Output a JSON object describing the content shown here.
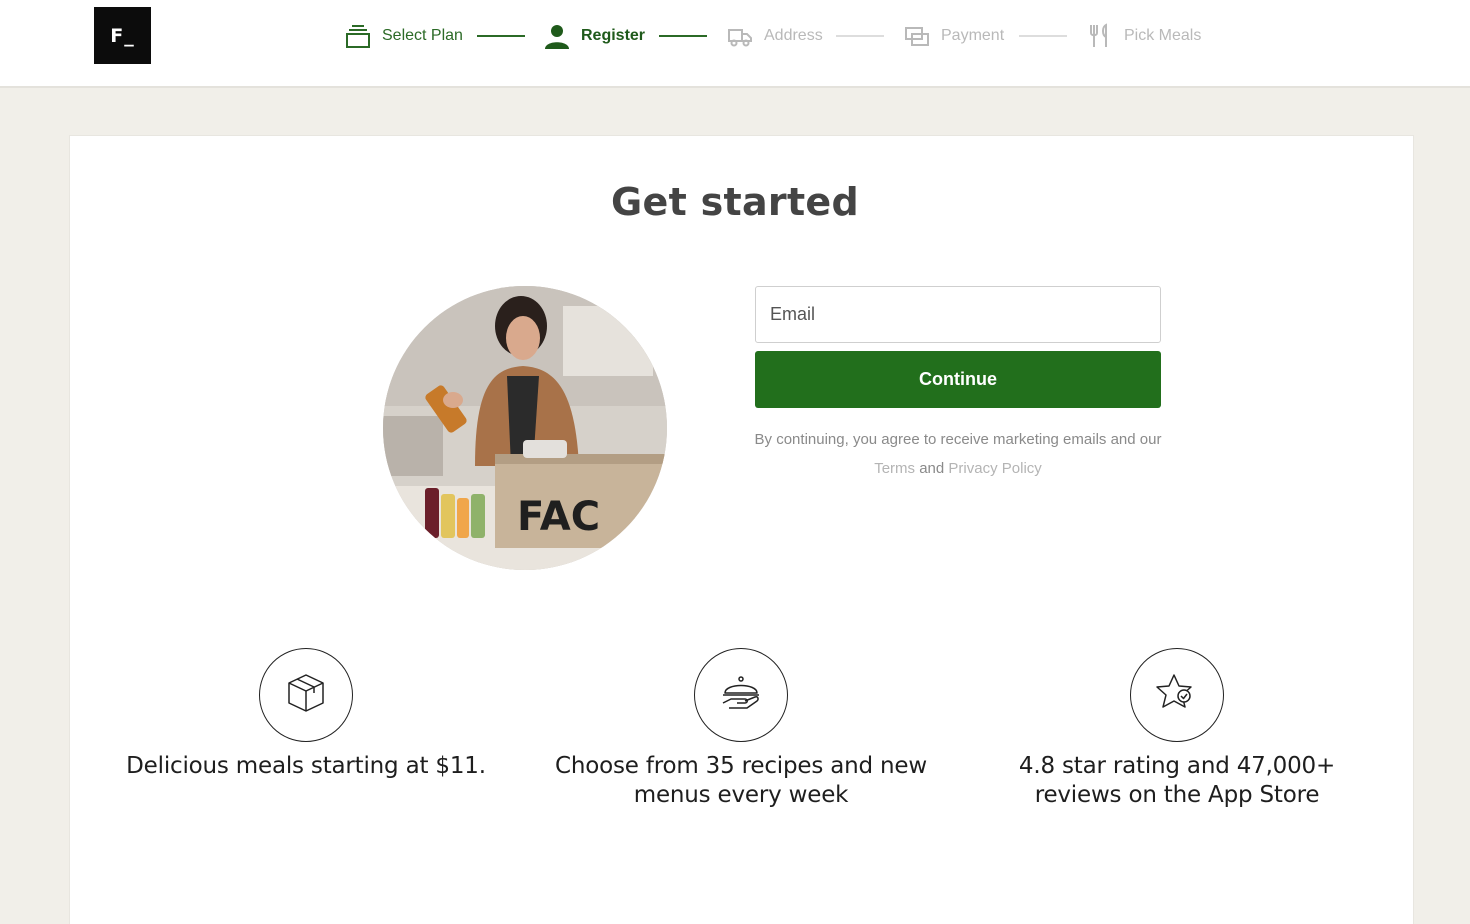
{
  "brand": {
    "logo_text": "F_"
  },
  "stepper": {
    "steps": [
      {
        "label": "Select Plan",
        "state": "completed",
        "icon": "layers-icon"
      },
      {
        "label": "Register",
        "state": "active",
        "icon": "user-icon"
      },
      {
        "label": "Address",
        "state": "upcoming",
        "icon": "delivery-truck-icon"
      },
      {
        "label": "Payment",
        "state": "upcoming",
        "icon": "credit-card-icon"
      },
      {
        "label": "Pick Meals",
        "state": "upcoming",
        "icon": "fork-knife-icon"
      }
    ]
  },
  "main": {
    "title": "Get started",
    "hero_image": {
      "box_text": "FAC"
    },
    "form": {
      "email_placeholder": "Email",
      "email_value": "",
      "continue_label": "Continue",
      "legal_prefix": "By continuing, you agree to receive marketing emails and our",
      "terms_label": "Terms",
      "and_label": "and",
      "privacy_label": "Privacy Policy"
    }
  },
  "features": [
    {
      "icon": "box-icon",
      "text": "Delicious meals starting at $11."
    },
    {
      "icon": "serving-cloche-icon",
      "text": "Choose from 35 recipes and new menus every week"
    },
    {
      "icon": "star-badge-icon",
      "text": "4.8 star rating and 47,000+ reviews on the App Store"
    }
  ],
  "colors": {
    "accent_green": "#226f1c",
    "step_completed": "#2b6a26",
    "step_upcoming": "#b9b9b9",
    "page_background": "#f1efe9"
  }
}
